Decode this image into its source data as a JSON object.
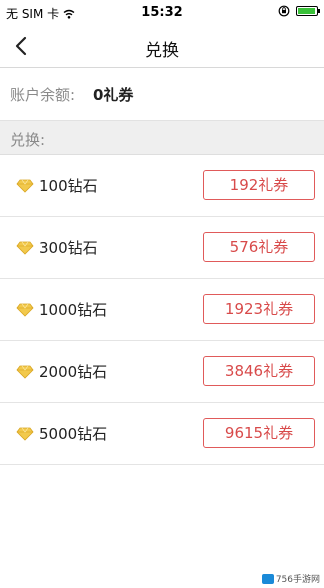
{
  "status_bar": {
    "carrier": "无 SIM 卡",
    "time": "15:32"
  },
  "nav": {
    "title": "兑换"
  },
  "balance": {
    "label": "账户余额:",
    "value": "0礼券"
  },
  "section": {
    "label": "兑换:"
  },
  "items": [
    {
      "name": "100钻石",
      "button": "192礼券"
    },
    {
      "name": "300钻石",
      "button": "576礼券"
    },
    {
      "name": "1000钻石",
      "button": "1923礼券"
    },
    {
      "name": "2000钻石",
      "button": "3846礼券"
    },
    {
      "name": "5000钻石",
      "button": "9615礼券"
    }
  ],
  "colors": {
    "accent": "#d84a4a",
    "gem": "#f2c94c",
    "battery": "#3ac13a"
  },
  "watermark": {
    "text": "756手游网"
  }
}
